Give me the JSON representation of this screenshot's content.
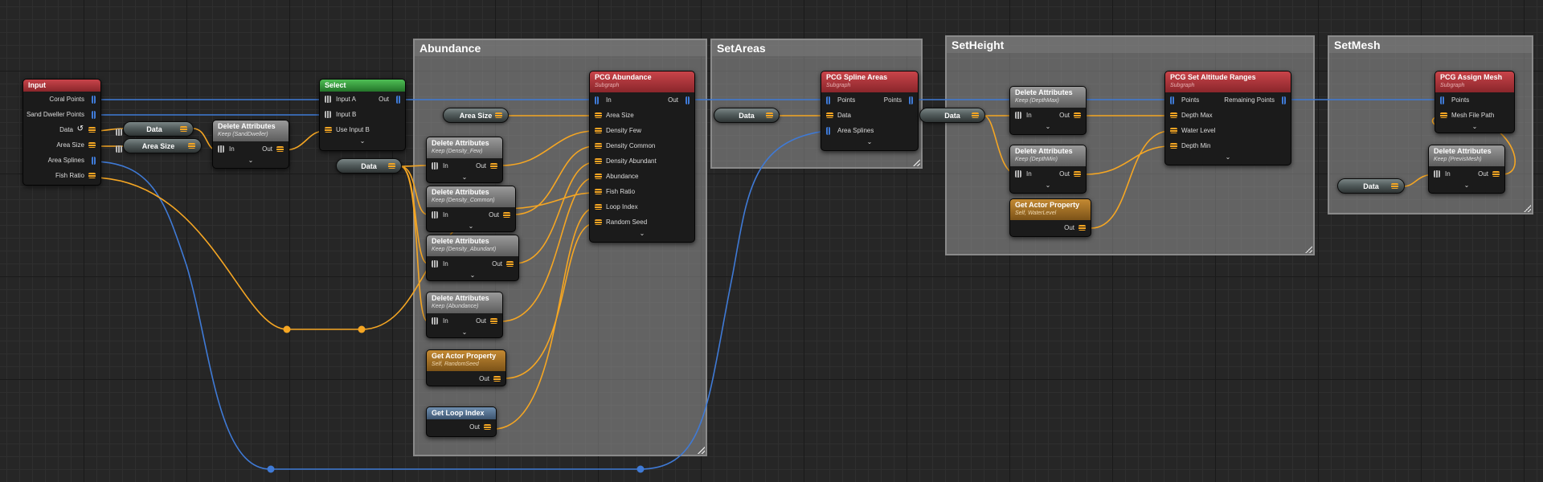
{
  "colors": {
    "param_pin": "#f5a623",
    "point_pin": "#3f7ad6",
    "header_red": "#b13a3f",
    "header_green": "#3e9f44",
    "header_grey": "#7d7d7d",
    "header_gold": "#a3742c",
    "header_blue": "#56738f",
    "comment_box": "#9a9a9a"
  },
  "comments": {
    "abundance": "Abundance",
    "setareas": "SetAreas",
    "setheight": "SetHeight",
    "setmesh": "SetMesh"
  },
  "input_node": {
    "title": "Input",
    "pins": [
      "Coral Points",
      "Sand Dweller Points",
      "Data",
      "Area Size",
      "Area Splines",
      "Fish Ratio"
    ]
  },
  "select_node": {
    "title": "Select",
    "pins": [
      "Input A",
      "Input B",
      "Use Input B"
    ],
    "out": "Out"
  },
  "reroutes": {
    "data": "Data",
    "area_size": "Area Size"
  },
  "delete_sand": {
    "title": "Delete Attributes",
    "subtitle": "Keep (SandDweller)",
    "in": "In",
    "out": "Out"
  },
  "del_density_few": {
    "title": "Delete Attributes",
    "subtitle": "Keep (Density_Few)",
    "in": "In",
    "out": "Out"
  },
  "del_density_common": {
    "title": "Delete Attributes",
    "subtitle": "Keep (Density_Common)",
    "in": "In",
    "out": "Out"
  },
  "del_density_abundant": {
    "title": "Delete Attributes",
    "subtitle": "Keep (Density_Abundant)",
    "in": "In",
    "out": "Out"
  },
  "del_abundance": {
    "title": "Delete Attributes",
    "subtitle": "Keep (Abundance)",
    "in": "In",
    "out": "Out"
  },
  "get_random_seed": {
    "title": "Get Actor Property",
    "subtitle": "Self, RandomSeed",
    "out": "Out"
  },
  "get_loop_index": {
    "title": "Get Loop Index",
    "out": "Out"
  },
  "pcg_abundance": {
    "title": "PCG Abundance",
    "subtitle": "Subgraph",
    "in": "In",
    "out": "Out",
    "pins": [
      "Area Size",
      "Density Few",
      "Density Common",
      "Density Abundant",
      "Abundance",
      "Fish Ratio",
      "Loop Index",
      "Random Seed"
    ]
  },
  "pcg_spline_areas": {
    "title": "PCG Spline Areas",
    "subtitle": "Subgraph",
    "pins": [
      "Points",
      "Data",
      "Area Splines"
    ],
    "out": "Points"
  },
  "del_depth_max": {
    "title": "Delete Attributes",
    "subtitle": "Keep (DepthMax)",
    "in": "In",
    "out": "Out"
  },
  "del_depth_min": {
    "title": "Delete Attributes",
    "subtitle": "Keep (DepthMin)",
    "in": "In",
    "out": "Out"
  },
  "get_water_level": {
    "title": "Get Actor Property",
    "subtitle": "Self, WaterLevel",
    "out": "Out"
  },
  "pcg_altitude": {
    "title": "PCG Set Altitude Ranges",
    "subtitle": "Subgraph",
    "pins": [
      "Points",
      "Depth Max",
      "Water Level",
      "Depth Min"
    ],
    "out": "Remaining Points"
  },
  "pcg_assign_mesh": {
    "title": "PCG Assign Mesh",
    "subtitle": "Subgraph",
    "pins": [
      "Points",
      "Mesh File Path"
    ]
  },
  "del_previs_mesh": {
    "title": "Delete Attributes",
    "subtitle": "Keep (PrevisMesh)",
    "in": "In",
    "out": "Out"
  }
}
